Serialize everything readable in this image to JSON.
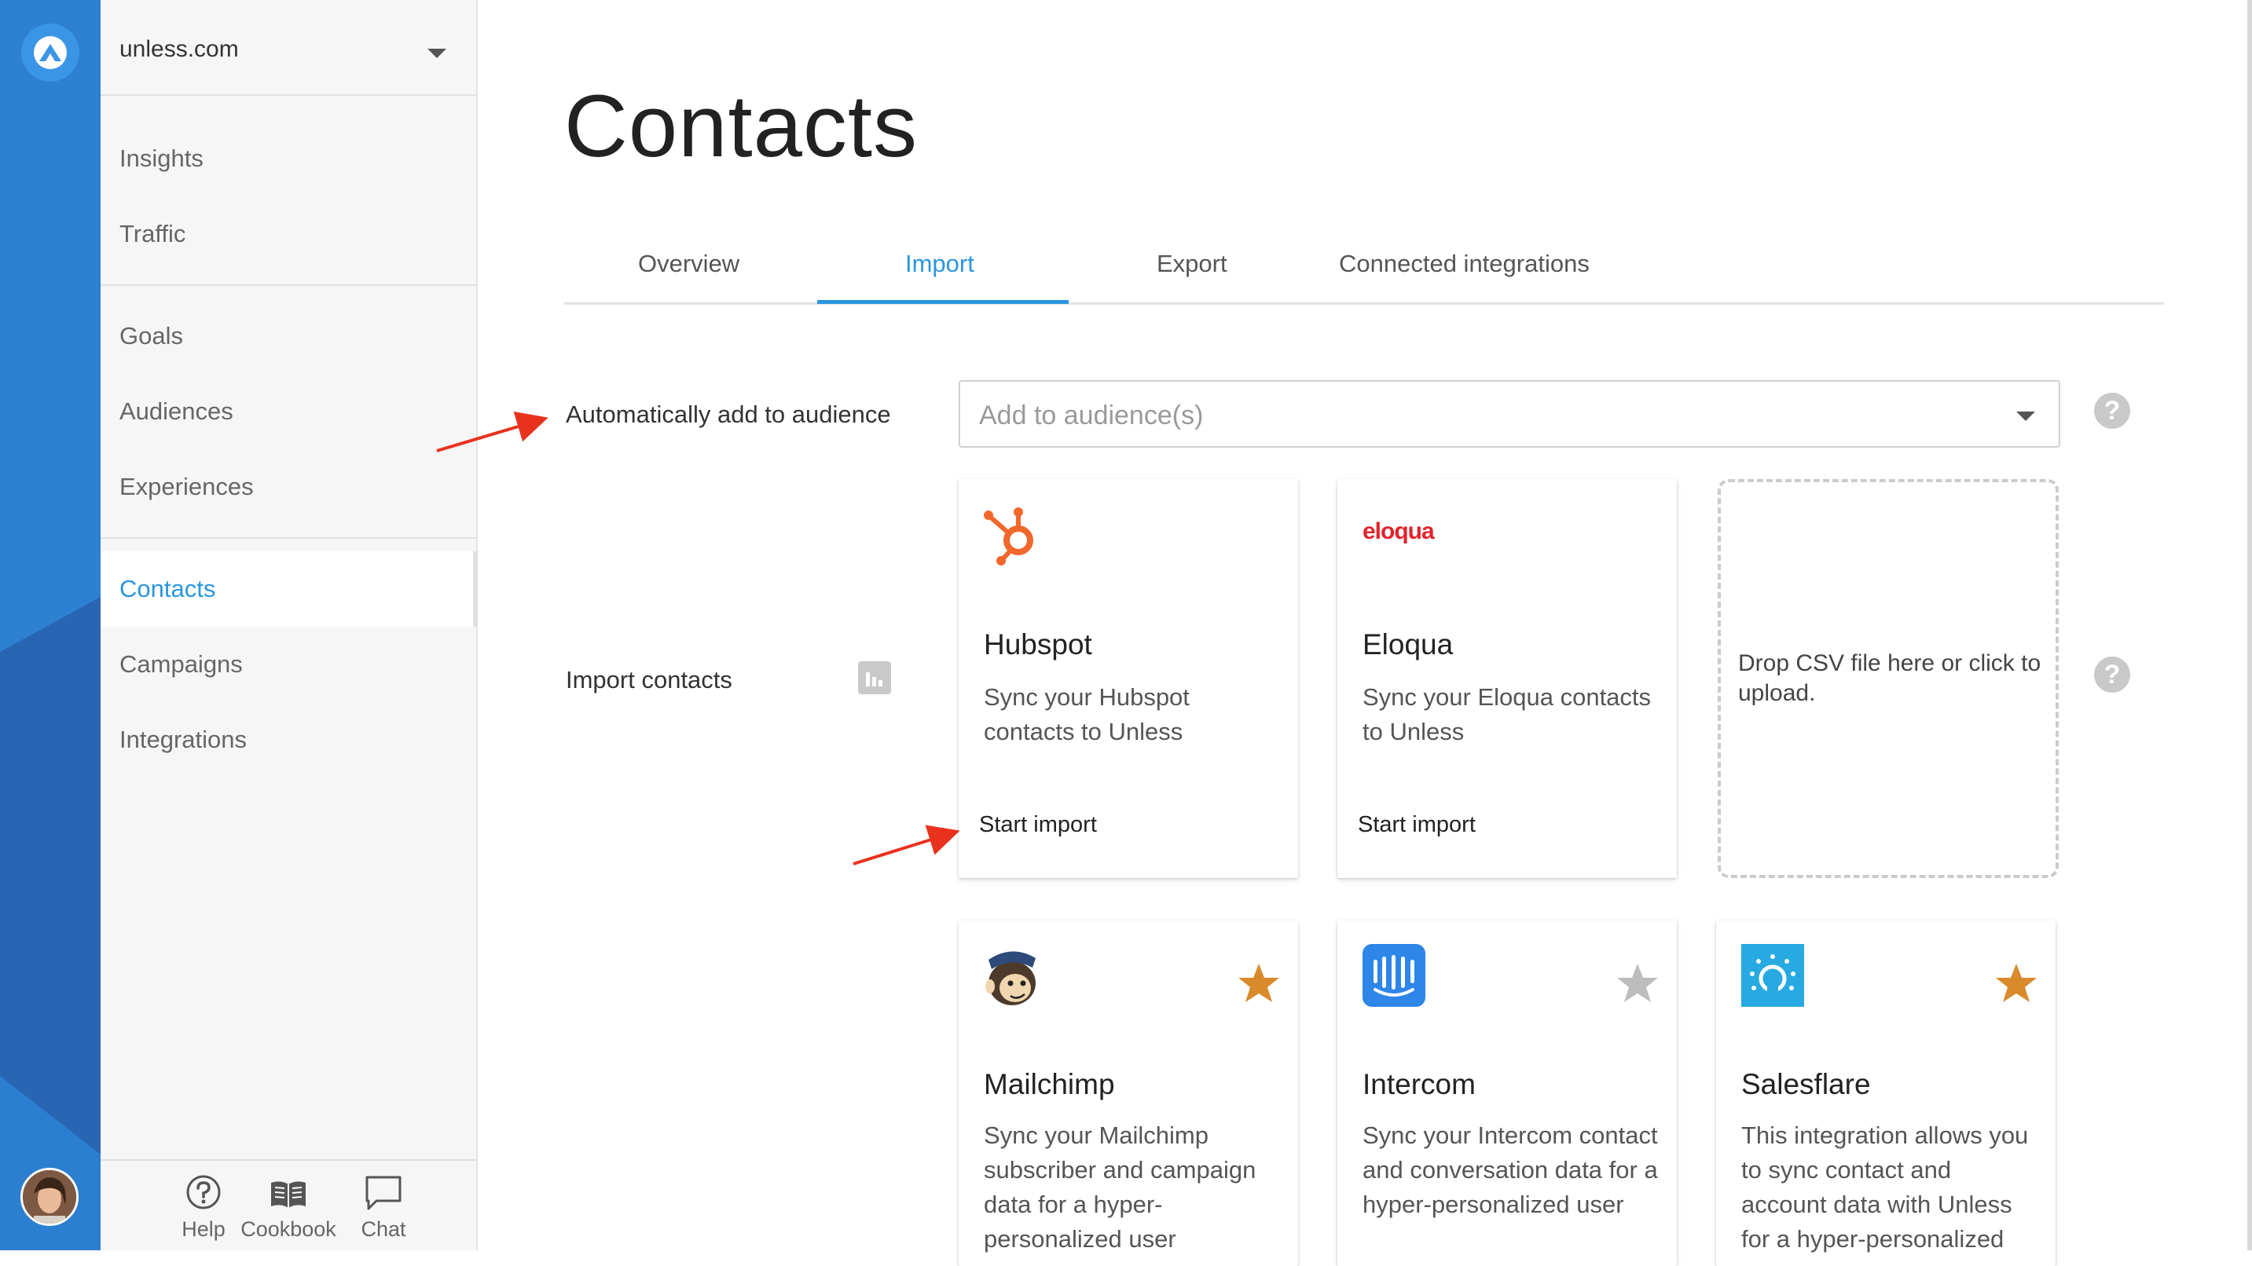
{
  "workspace": {
    "name": "unless.com"
  },
  "sidebar": {
    "groups": [
      {
        "items": [
          {
            "label": "Insights"
          },
          {
            "label": "Traffic"
          }
        ]
      },
      {
        "items": [
          {
            "label": "Goals"
          },
          {
            "label": "Audiences"
          },
          {
            "label": "Experiences"
          }
        ]
      },
      {
        "items": [
          {
            "label": "Contacts",
            "active": true
          },
          {
            "label": "Campaigns"
          },
          {
            "label": "Integrations"
          }
        ]
      }
    ],
    "footer": [
      {
        "label": "Help",
        "icon": "help-circle-icon"
      },
      {
        "label": "Cookbook",
        "icon": "book-icon"
      },
      {
        "label": "Chat",
        "icon": "chat-bubble-icon"
      }
    ]
  },
  "page": {
    "title": "Contacts"
  },
  "tabs": [
    {
      "label": "Overview",
      "active": false
    },
    {
      "label": "Import",
      "active": true
    },
    {
      "label": "Export",
      "active": false
    },
    {
      "label": "Connected integrations",
      "active": false
    }
  ],
  "audience": {
    "label": "Automatically add to audience",
    "placeholder": "Add to audience(s)"
  },
  "import": {
    "label": "Import contacts",
    "dropzone_text": "Drop CSV file here or click to upload."
  },
  "cards": [
    {
      "title": "Hubspot",
      "desc": "Sync your Hubspot contacts to Unless",
      "action": "Start import",
      "logo": "hubspot-logo"
    },
    {
      "title": "Eloqua",
      "desc": "Sync your Eloqua contacts to Unless",
      "action": "Start import",
      "logo": "eloqua-logo",
      "logo_text": "eloqua"
    },
    {
      "title": "Mailchimp",
      "desc": "Sync your Mailchimp subscriber and campaign data for a hyper-personalized user",
      "logo": "mailchimp-logo",
      "starred": true
    },
    {
      "title": "Intercom",
      "desc": "Sync your Intercom contact and conversation data for a hyper-personalized user",
      "logo": "intercom-logo",
      "starred": false
    },
    {
      "title": "Salesflare",
      "desc": "This integration allows you to sync contact and account data with Unless for a hyper-personalized",
      "logo": "salesflare-logo",
      "starred": true
    }
  ],
  "colors": {
    "brand_blue": "#2d80d2",
    "accent": "#2b96e0",
    "star_active": "#d98a2b",
    "star_inactive": "#bdbdbd",
    "annotation_arrow": "#e8321e",
    "hubspot": "#f2672b",
    "eloqua": "#e0242c",
    "intercom": "#2d86e8",
    "salesflare": "#27a9e1"
  }
}
